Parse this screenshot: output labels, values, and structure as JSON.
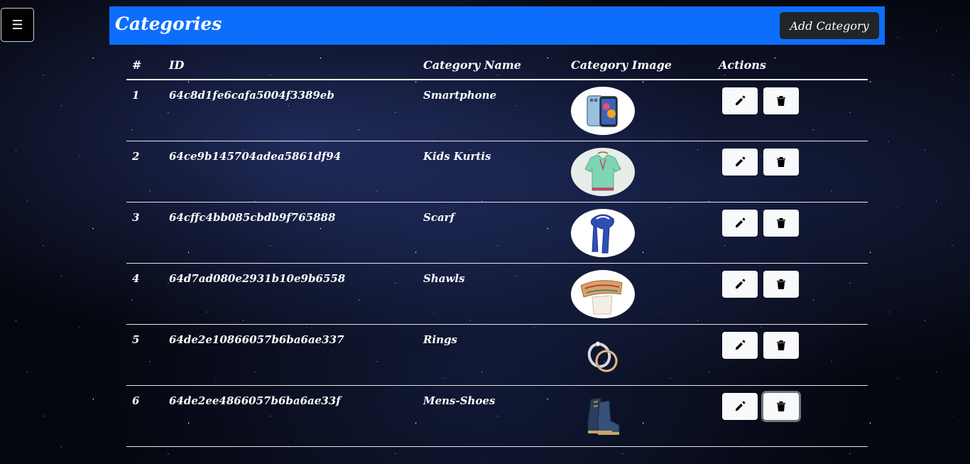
{
  "menu_icon": "hamburger-icon",
  "header": {
    "title": "Categories",
    "add_button": "Add Category",
    "accent_color": "#0d6efd"
  },
  "table": {
    "columns": [
      "#",
      "ID",
      "Category Name",
      "Category Image",
      "Actions"
    ],
    "rows": [
      {
        "num": "1",
        "id": "64c8d1fe6cafa5004f3389eb",
        "name": "Smartphone",
        "image": "smartphone-image"
      },
      {
        "num": "2",
        "id": "64ce9b145704adea5861df94",
        "name": "Kids Kurtis",
        "image": "kurti-image"
      },
      {
        "num": "3",
        "id": "64cffc4bb085cbdb9f765888",
        "name": "Scarf",
        "image": "scarf-image"
      },
      {
        "num": "4",
        "id": "64d7ad080e2931b10e9b6558",
        "name": "Shawls",
        "image": "shawl-image"
      },
      {
        "num": "5",
        "id": "64de2e10866057b6ba6ae337",
        "name": "Rings",
        "image": "rings-image"
      },
      {
        "num": "6",
        "id": "64de2ee4866057b6ba6ae33f",
        "name": "Mens-Shoes",
        "image": "shoes-image"
      }
    ],
    "action_icons": [
      "pencil-icon",
      "trash-icon"
    ]
  }
}
